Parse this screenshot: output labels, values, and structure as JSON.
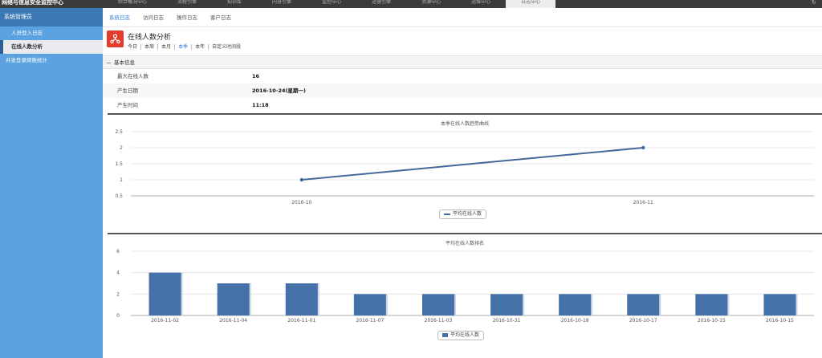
{
  "app": {
    "title": "网络与信息安全监控中心"
  },
  "top_nav": [
    "综合概况中心",
    "流程引擎",
    "知识库",
    "内容引擎",
    "监控中心",
    "运营引擎",
    "资源中心",
    "运维中心",
    "日志中心"
  ],
  "top_nav_active": 8,
  "sidebar": {
    "header": "系统管理员",
    "items": [
      {
        "label": "人员登入日志"
      },
      {
        "label": "在线人数分析"
      },
      {
        "label": "并发登录频数统计"
      }
    ],
    "active": 1
  },
  "sub_tabs": [
    "系统日志",
    "访问日志",
    "操作日志",
    "客户日志"
  ],
  "sub_tab_active": 0,
  "page": {
    "title": "在线人数分析",
    "periods": [
      "今日",
      "本周",
      "本月",
      "本季",
      "本年",
      "自定义时间段"
    ],
    "period_active": 3
  },
  "info": {
    "header": "基本信息",
    "rows": [
      {
        "label": "最大在线人数",
        "value": "16"
      },
      {
        "label": "产生日期",
        "value": "2016-10-24(星期一)"
      },
      {
        "label": "产生时间",
        "value": "11:18"
      }
    ]
  },
  "charts": {
    "line_legend": "平均在线人数",
    "bar_legend": "平均在线人数"
  },
  "chart_data": [
    {
      "type": "line",
      "title": "本季在线人数趋势曲线",
      "categories": [
        "2016-10",
        "2016-11"
      ],
      "series": [
        {
          "name": "平均在线人数",
          "values": [
            1,
            2
          ]
        }
      ],
      "ylim": [
        0.5,
        2.5
      ],
      "yticks": [
        0.5,
        1,
        1.5,
        2,
        2.5
      ],
      "color": "#43699c",
      "grid": true,
      "legend": "bottom-center"
    },
    {
      "type": "bar",
      "title": "平均在线人数排名",
      "categories": [
        "2016-11-02",
        "2016-11-04",
        "2016-11-01",
        "2016-11-07",
        "2016-11-03",
        "2016-10-31",
        "2016-10-18",
        "2016-10-17",
        "2016-10-15",
        "2016-10-15"
      ],
      "series": [
        {
          "name": "平均在线人数",
          "values": [
            4,
            3,
            3,
            2,
            2,
            2,
            2,
            2,
            2,
            2
          ]
        }
      ],
      "ylim": [
        0,
        6
      ],
      "yticks": [
        0,
        2,
        4,
        6
      ],
      "color": "#4472a8",
      "grid": true,
      "legend": "bottom-center"
    }
  ]
}
